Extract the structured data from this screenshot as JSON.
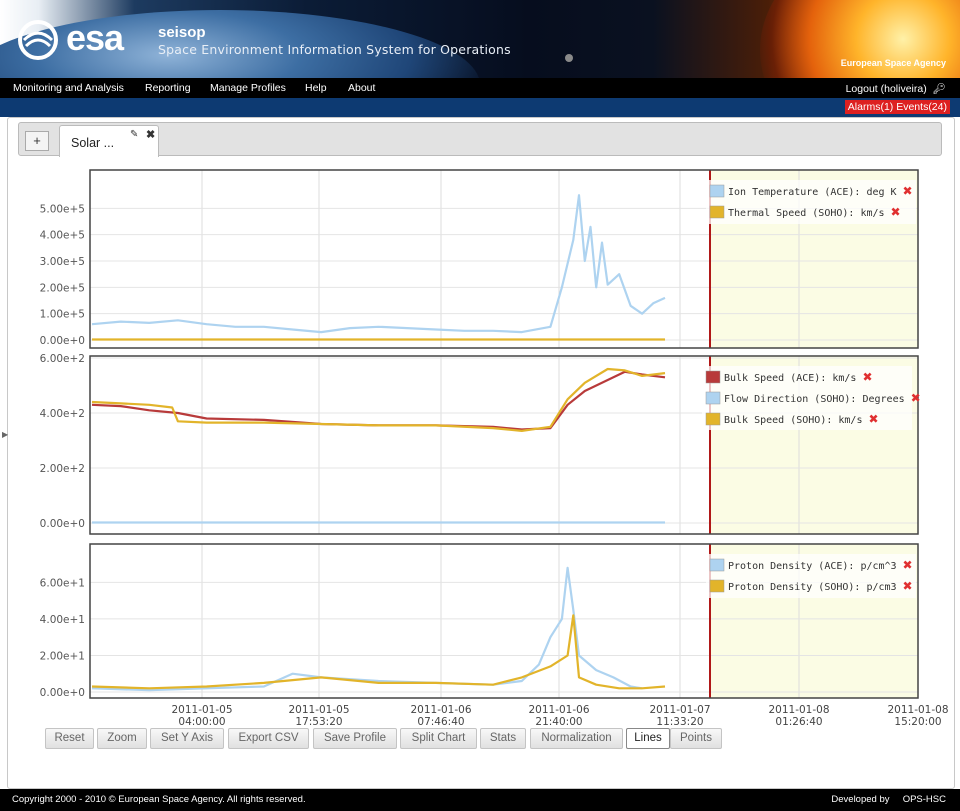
{
  "header": {
    "logo_text": "esa",
    "app_name": "seisop",
    "app_subtitle": "Space Environment Information System for Operations",
    "agency": "European Space Agency"
  },
  "menu": {
    "items": [
      {
        "label": "Monitoring and Analysis"
      },
      {
        "label": "Reporting"
      },
      {
        "label": "Manage Profiles"
      },
      {
        "label": "Help"
      },
      {
        "label": "About"
      }
    ],
    "logout": "Logout (holiveira)"
  },
  "alerts": {
    "text": "Alarms(1) Events(24)"
  },
  "tabs": {
    "add": "+",
    "active_label": "Solar ..."
  },
  "toolbar": {
    "buttons": [
      "Reset",
      "Zoom",
      "Set Y Axis",
      "Export CSV",
      "Save Profile",
      "Split Chart",
      "Stats",
      "Normalization",
      "Lines",
      "Points"
    ],
    "active": "Lines"
  },
  "footer": {
    "copyright": "Copyright 2000 - 2010 © European Space Agency. All rights reserved.",
    "developed_by": "Developed by",
    "developer": "OPS-HSC"
  },
  "colors": {
    "ace_blue": "#aed3f0",
    "soho_yellow": "#e2b42a",
    "ace_red": "#b83a3a",
    "now_line": "#b01818",
    "future_bg": "#fbfce4",
    "remove_icon": "#e03030"
  },
  "chart_data": [
    {
      "type": "line",
      "xlabels": [
        "2011-01-05\n04:00:00",
        "2011-01-05\n17:53:20",
        "2011-01-06\n07:46:40",
        "2011-01-06\n21:40:00",
        "2011-01-07\n11:33:20",
        "2011-01-08\n01:26:40",
        "2011-01-08\n15:20:00"
      ],
      "yticks": [
        "0.00e+0",
        "1.00e+5",
        "2.00e+5",
        "3.00e+5",
        "4.00e+5",
        "5.00e+5"
      ],
      "ylim": [
        0,
        600000
      ],
      "series": [
        {
          "name": "Ion Temperature (ACE): deg K",
          "color": "#aed3f0",
          "points": [
            [
              0,
              60000
            ],
            [
              5,
              70000
            ],
            [
              10,
              65000
            ],
            [
              15,
              75000
            ],
            [
              20,
              60000
            ],
            [
              25,
              50000
            ],
            [
              30,
              50000
            ],
            [
              35,
              40000
            ],
            [
              40,
              30000
            ],
            [
              45,
              45000
            ],
            [
              50,
              50000
            ],
            [
              55,
              45000
            ],
            [
              60,
              40000
            ],
            [
              65,
              35000
            ],
            [
              70,
              35000
            ],
            [
              75,
              30000
            ],
            [
              80,
              50000
            ],
            [
              82,
              200000
            ],
            [
              84,
              380000
            ],
            [
              85,
              550000
            ],
            [
              86,
              300000
            ],
            [
              87,
              430000
            ],
            [
              88,
              200000
            ],
            [
              89,
              370000
            ],
            [
              90,
              210000
            ],
            [
              92,
              250000
            ],
            [
              94,
              130000
            ],
            [
              96,
              100000
            ],
            [
              98,
              140000
            ],
            [
              100,
              160000
            ]
          ]
        },
        {
          "name": "Thermal Speed (SOHO): km/s",
          "color": "#e2b42a",
          "points": [
            [
              0,
              2000
            ],
            [
              100,
              2000
            ]
          ]
        }
      ]
    },
    {
      "type": "line",
      "xlabels": [],
      "yticks": [
        "0.00e+0",
        "2.00e+2",
        "4.00e+2",
        "6.00e+2"
      ],
      "ylim": [
        0,
        600
      ],
      "series": [
        {
          "name": "Bulk Speed (ACE): km/s",
          "color": "#b83a3a",
          "points": [
            [
              0,
              430
            ],
            [
              5,
              425
            ],
            [
              10,
              410
            ],
            [
              15,
              400
            ],
            [
              20,
              380
            ],
            [
              30,
              375
            ],
            [
              40,
              360
            ],
            [
              50,
              355
            ],
            [
              60,
              355
            ],
            [
              70,
              350
            ],
            [
              75,
              340
            ],
            [
              80,
              345
            ],
            [
              83,
              430
            ],
            [
              86,
              480
            ],
            [
              90,
              520
            ],
            [
              93,
              550
            ],
            [
              96,
              540
            ],
            [
              100,
              530
            ]
          ]
        },
        {
          "name": "Flow Direction (SOHO): Degrees",
          "color": "#aed3f0",
          "points": [
            [
              0,
              2
            ],
            [
              100,
              2
            ]
          ]
        },
        {
          "name": "Bulk Speed (SOHO): km/s",
          "color": "#e2b42a",
          "points": [
            [
              0,
              440
            ],
            [
              5,
              435
            ],
            [
              10,
              430
            ],
            [
              14,
              420
            ],
            [
              15,
              370
            ],
            [
              20,
              365
            ],
            [
              30,
              365
            ],
            [
              40,
              360
            ],
            [
              50,
              355
            ],
            [
              60,
              355
            ],
            [
              70,
              345
            ],
            [
              75,
              335
            ],
            [
              80,
              350
            ],
            [
              83,
              450
            ],
            [
              86,
              510
            ],
            [
              90,
              560
            ],
            [
              93,
              555
            ],
            [
              96,
              535
            ],
            [
              100,
              545
            ]
          ]
        }
      ]
    },
    {
      "type": "line",
      "xlabels": [],
      "yticks": [
        "0.00e+0",
        "2.00e+1",
        "4.00e+1",
        "6.00e+1"
      ],
      "ylim": [
        0,
        75
      ],
      "series": [
        {
          "name": "Proton Density (ACE): p/cm^3",
          "color": "#aed3f0",
          "points": [
            [
              0,
              2
            ],
            [
              10,
              1
            ],
            [
              20,
              2
            ],
            [
              30,
              3
            ],
            [
              35,
              10
            ],
            [
              40,
              8
            ],
            [
              50,
              6
            ],
            [
              60,
              5
            ],
            [
              70,
              4
            ],
            [
              75,
              6
            ],
            [
              78,
              15
            ],
            [
              80,
              30
            ],
            [
              82,
              40
            ],
            [
              83,
              68
            ],
            [
              84,
              45
            ],
            [
              85,
              20
            ],
            [
              88,
              12
            ],
            [
              91,
              8
            ],
            [
              94,
              3
            ],
            [
              96,
              2
            ]
          ]
        },
        {
          "name": "Proton Density (SOHO): p/cm3",
          "color": "#e2b42a",
          "points": [
            [
              0,
              3
            ],
            [
              10,
              2
            ],
            [
              20,
              3
            ],
            [
              30,
              5
            ],
            [
              40,
              8
            ],
            [
              50,
              5
            ],
            [
              60,
              5
            ],
            [
              70,
              4
            ],
            [
              75,
              8
            ],
            [
              80,
              14
            ],
            [
              83,
              20
            ],
            [
              84,
              42
            ],
            [
              85,
              8
            ],
            [
              88,
              4
            ],
            [
              92,
              2
            ],
            [
              96,
              2
            ],
            [
              100,
              3
            ]
          ]
        }
      ]
    }
  ]
}
